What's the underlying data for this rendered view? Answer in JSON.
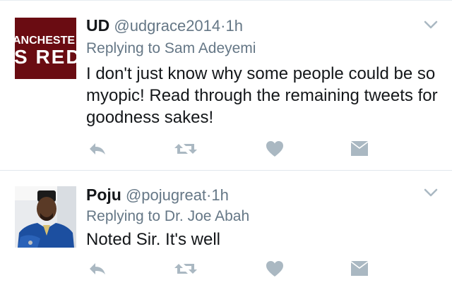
{
  "tweets": [
    {
      "avatar_text_line1": "ANCHESTE",
      "avatar_text_line2": "S RED",
      "name": "UD",
      "handle": "@udgrace2014",
      "separator": "·",
      "time": "1h",
      "reply_prefix": "Replying to",
      "reply_to": "Sam Adeyemi",
      "body": "I don't just know why some people could be so myopic! Read through the remaining tweets for goodness sakes!"
    },
    {
      "name": "Poju",
      "handle": "@pojugreat",
      "separator": "·",
      "time": "1h",
      "reply_prefix": "Replying to",
      "reply_to": "Dr. Joe Abah",
      "body": "Noted Sir. It's well"
    }
  ],
  "icons": {
    "reply": "reply-icon",
    "retweet": "retweet-icon",
    "like": "heart-icon",
    "dm": "envelope-icon",
    "menu": "chevron-down-icon"
  },
  "colors": {
    "icon_gray": "#aab8c2",
    "secondary_text": "#657786",
    "primary_text": "#14171a",
    "avatar_red": "#6a0c12"
  }
}
